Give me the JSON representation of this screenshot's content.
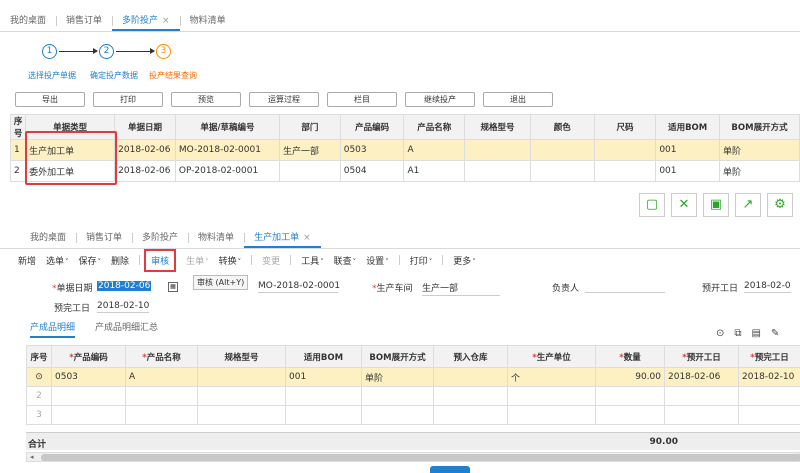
{
  "top_tabs": [
    {
      "label": "我的桌面"
    },
    {
      "label": "销售订单"
    },
    {
      "label": "多阶投产",
      "close": "×"
    },
    {
      "label": "物料清单"
    }
  ],
  "steps": [
    {
      "num": "1",
      "label": "选择投产单据"
    },
    {
      "num": "2",
      "label": "确定投产数据"
    },
    {
      "num": "3",
      "label": "投产结果查询"
    }
  ],
  "actions": [
    "导出",
    "打印",
    "预览",
    "运算过程",
    "栏目",
    "继续投产",
    "退出"
  ],
  "top_table": {
    "headers": [
      "序号",
      "单据类型",
      "单据日期",
      "单据/草稿编号",
      "部门",
      "产品编码",
      "产品名称",
      "规格型号",
      "颜色",
      "尺码",
      "适用BOM",
      "BOM展开方式"
    ],
    "rows": [
      [
        "1",
        "生产加工单",
        "2018-02-06",
        "MO-2018-02-0001",
        "生产一部",
        "0503",
        "A",
        "",
        "",
        "",
        "001",
        "单阶"
      ],
      [
        "2",
        "委外加工单",
        "2018-02-06",
        "OP-2018-02-0001",
        "",
        "0504",
        "A1",
        "",
        "",
        "",
        "001",
        "单阶"
      ]
    ]
  },
  "bottom_tabs": [
    {
      "label": "我的桌面"
    },
    {
      "label": "销售订单"
    },
    {
      "label": "多阶投产"
    },
    {
      "label": "物料清单"
    },
    {
      "label": "生产加工单",
      "close": "×"
    }
  ],
  "toolbar": {
    "new": "新增",
    "pick": "选单",
    "save": "保存",
    "delete": "删除",
    "audit": "审核",
    "gen": "生单",
    "convert": "转换",
    "change": "变更",
    "tools": "工具",
    "query": "联查",
    "settings": "设置",
    "print": "打印",
    "more": "更多",
    "tooltip": "审核 (Alt+Y)"
  },
  "form": {
    "date_label": "单据日期",
    "date_value": "2018-02-06",
    "code_value": "MO-2018-02-0001",
    "workshop_label": "生产车间",
    "workshop_value": "生产一部",
    "owner_label": "负责人",
    "start_label": "预开工日",
    "start_value": "2018-02-0",
    "end_label": "预完工日",
    "end_value": "2018-02-10"
  },
  "subtabs": [
    "产成品明细",
    "产成品明细汇总"
  ],
  "bottom_table": {
    "headers": [
      "序号",
      "产品编码",
      "产品名称",
      "规格型号",
      "适用BOM",
      "BOM展开方式",
      "预入仓库",
      "生产单位",
      "数量",
      "预开工日",
      "预完工日"
    ],
    "required": [
      false,
      true,
      true,
      false,
      false,
      false,
      false,
      true,
      true,
      true,
      true
    ],
    "row": [
      "",
      "0503",
      "A",
      "",
      "001",
      "单阶",
      "",
      "个",
      "90.00",
      "2018-02-06",
      "2018-02-10"
    ],
    "empty_rows": [
      "2",
      "3"
    ]
  },
  "sum": {
    "label": "合计",
    "qty": "90.00"
  },
  "colors": {
    "accent": "#1f7fd0",
    "highlight_row": "#fdf0c2",
    "annotation": "#e03c3c",
    "icon_green": "#2aa52a"
  }
}
